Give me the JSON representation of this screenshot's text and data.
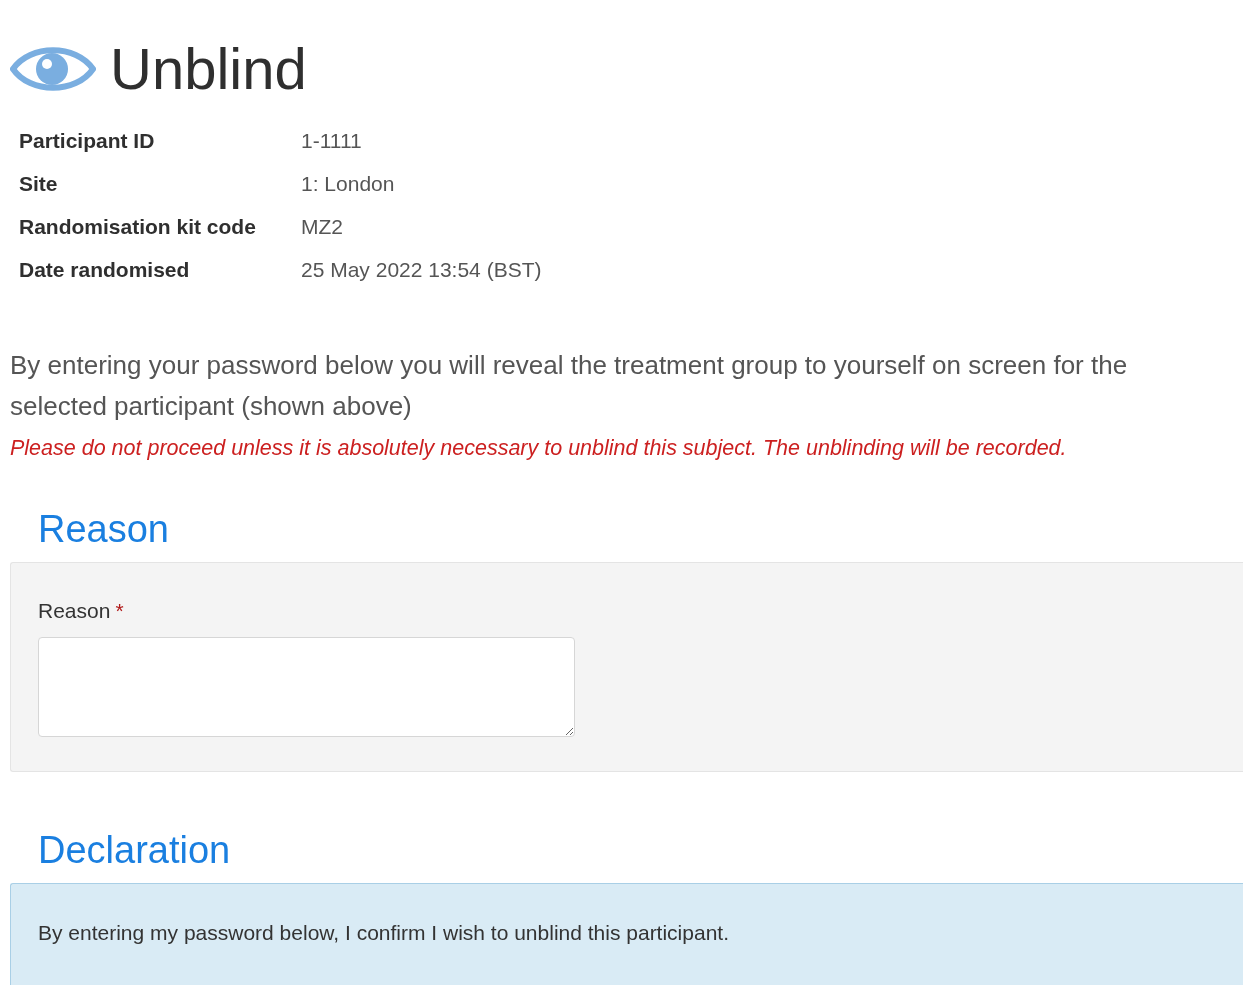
{
  "title": "Unblind",
  "details": [
    {
      "label": "Participant ID",
      "value": "1-1111"
    },
    {
      "label": "Site",
      "value": "1: London"
    },
    {
      "label": "Randomisation kit code",
      "value": "MZ2"
    },
    {
      "label": "Date randomised",
      "value": "25 May 2022 13:54 (BST)"
    }
  ],
  "intro": "By entering your password below you will reveal the treatment group to yourself on screen for the selected participant (shown above)",
  "warning": "Please do not proceed unless it is absolutely necessary to unblind this subject. The unblinding will be recorded.",
  "reason_section": {
    "heading": "Reason",
    "field_label": "Reason",
    "required_mark": "*"
  },
  "declaration_section": {
    "heading": "Declaration",
    "text": "By entering my password below, I confirm I wish to unblind this participant."
  }
}
